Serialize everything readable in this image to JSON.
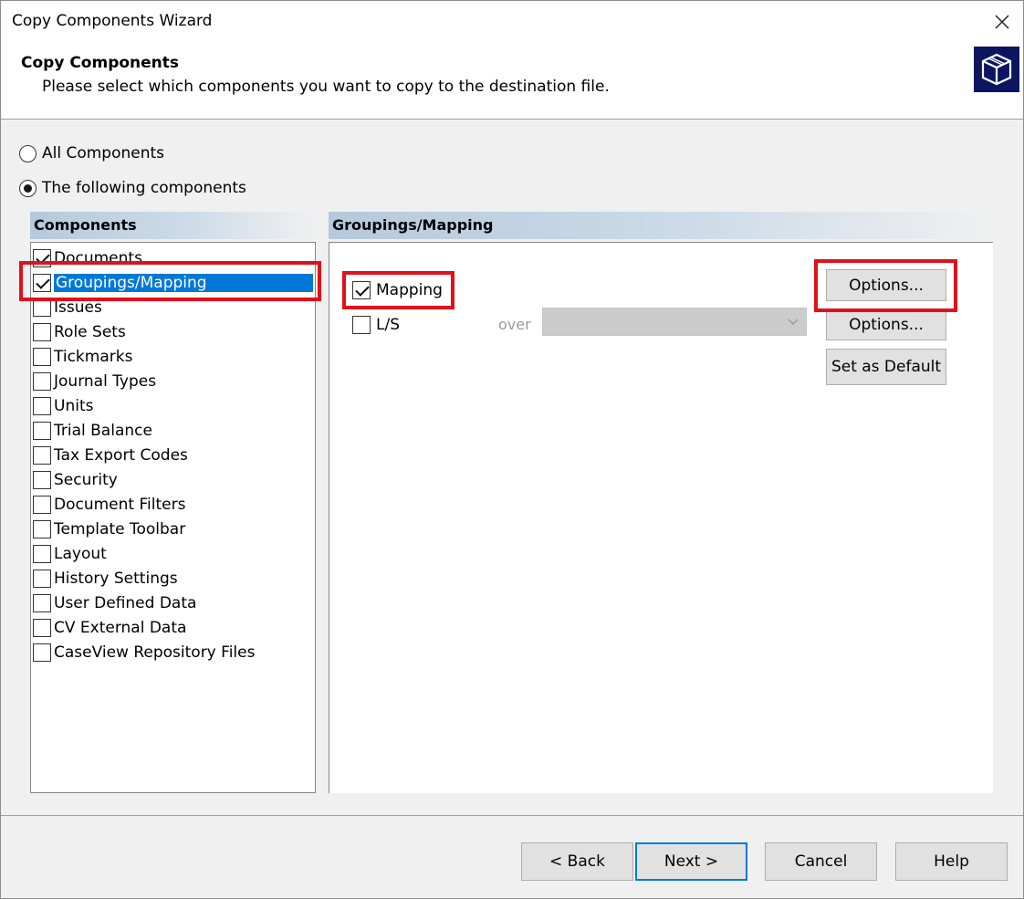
{
  "window": {
    "title": "Copy Components Wizard"
  },
  "header": {
    "title": "Copy Components",
    "subtitle": "Please select which components you want to copy to the destination file."
  },
  "radios": [
    {
      "label": "All Components",
      "checked": false
    },
    {
      "label": "The following components",
      "checked": true
    }
  ],
  "components_panel": {
    "title": "Components",
    "items": [
      {
        "label": "Documents",
        "checked": true
      },
      {
        "label": "Groupings/Mapping",
        "checked": true,
        "selected": true
      },
      {
        "label": "Issues",
        "checked": false
      },
      {
        "label": "Role Sets",
        "checked": false
      },
      {
        "label": "Tickmarks",
        "checked": false
      },
      {
        "label": "Journal Types",
        "checked": false
      },
      {
        "label": "Units",
        "checked": false
      },
      {
        "label": "Trial Balance",
        "checked": false
      },
      {
        "label": "Tax Export Codes",
        "checked": false
      },
      {
        "label": "Security",
        "checked": false
      },
      {
        "label": "Document Filters",
        "checked": false
      },
      {
        "label": "Template Toolbar",
        "checked": false
      },
      {
        "label": "Layout",
        "checked": false
      },
      {
        "label": "History Settings",
        "checked": false
      },
      {
        "label": "User Defined Data",
        "checked": false
      },
      {
        "label": "CV External Data",
        "checked": false
      },
      {
        "label": "CaseView Repository Files",
        "checked": false
      }
    ]
  },
  "detail_panel": {
    "title": "Groupings/Mapping",
    "mapping_label": "Mapping",
    "mapping_checked": true,
    "ls_label": "L/S",
    "ls_checked": false,
    "over_label": "over",
    "dropdown_value": "",
    "options_label_1": "Options...",
    "options_label_2": "Options...",
    "set_default_label": "Set as Default"
  },
  "footer": {
    "back_label": "< Back",
    "next_label": "Next >",
    "cancel_label": "Cancel",
    "help_label": "Help"
  },
  "colors": {
    "highlight": "#e0111b",
    "selection": "#0078d7",
    "logo_bg": "#0c1660"
  }
}
